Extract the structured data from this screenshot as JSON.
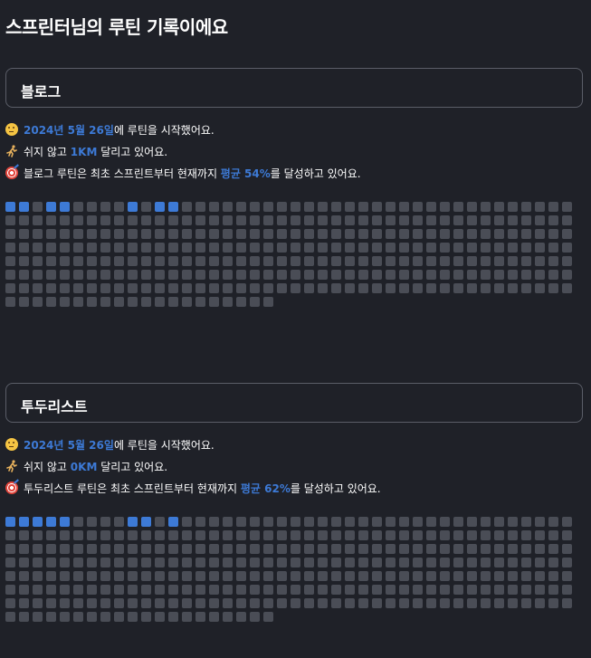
{
  "title": "스프린터님의 루틴 기록이에요",
  "colors": {
    "background": "#1f2128",
    "accent": "#3d7ad6",
    "empty_cell": "#4a4d56",
    "border": "#5b5e68"
  },
  "routines": [
    {
      "name": "블로그",
      "start_prefix_icon": "thinking-face-icon",
      "start_date": "2024년 5월 26일",
      "start_suffix": "에 루틴을 시작했어요.",
      "distance_icon": "runner-icon",
      "distance_prefix": "쉬지 않고 ",
      "distance": "1KM",
      "distance_suffix": " 달리고 있어요.",
      "average_icon": "target-icon",
      "average_prefix": "블로그 루틴은 최초 스프린트부터 현재까지 ",
      "average": "평균 54%",
      "average_suffix": "를 달성하고 있어요.",
      "days_total": 314,
      "days_completed_indices": [
        0,
        1,
        3,
        4,
        9,
        11,
        12
      ]
    },
    {
      "name": "투두리스트",
      "start_prefix_icon": "thinking-face-icon",
      "start_date": "2024년 5월 26일",
      "start_suffix": "에 루틴을 시작했어요.",
      "distance_icon": "runner-icon",
      "distance_prefix": "쉬지 않고 ",
      "distance": "0KM",
      "distance_suffix": " 달리고 있어요.",
      "average_icon": "target-icon",
      "average_prefix": "투두리스트 루틴은 최초 스프린트부터 현재까지 ",
      "average": "평균 62%",
      "average_suffix": "를 달성하고 있어요.",
      "days_total": 314,
      "days_completed_indices": [
        0,
        1,
        2,
        3,
        4,
        9,
        10,
        12
      ]
    }
  ]
}
